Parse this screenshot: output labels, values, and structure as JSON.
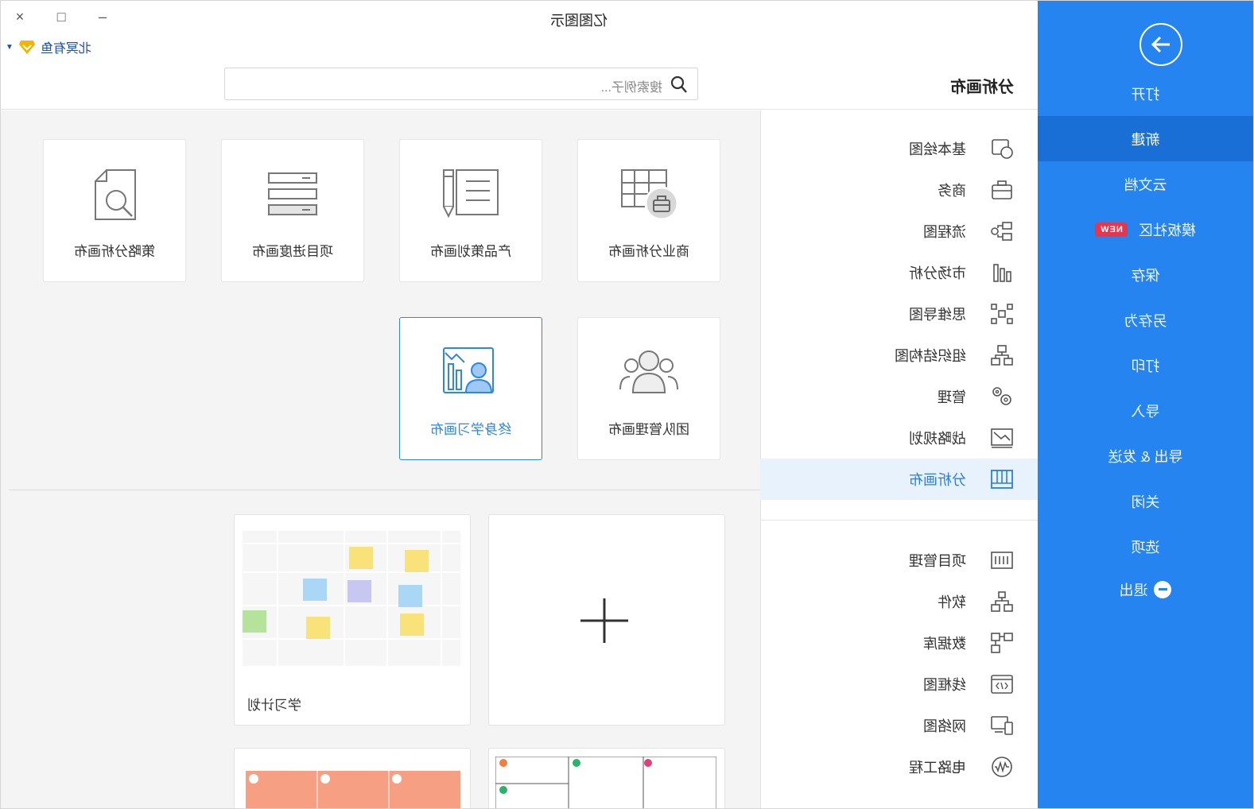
{
  "window": {
    "title": "亿图图示",
    "close_label": "×",
    "maximize_label": "□",
    "minimize_label": "–"
  },
  "user": {
    "name": "北冥有鱼"
  },
  "search": {
    "placeholder": "搜索例子..."
  },
  "command_panel": {
    "open_label": "打开",
    "items": [
      {
        "label": "新建",
        "active": true
      },
      {
        "label": "云文档"
      },
      {
        "label": "模板社区",
        "badge": "NEW"
      },
      {
        "label": "保存"
      },
      {
        "label": "另存为"
      },
      {
        "label": "打印"
      },
      {
        "label": "导入"
      },
      {
        "label": "导出 & 发送"
      },
      {
        "label": "关闭"
      },
      {
        "label": "选项"
      },
      {
        "label": "退出"
      }
    ],
    "accent_color": "#2684f0"
  },
  "categories": {
    "title": "分析画布",
    "group1": [
      {
        "label": "基本绘图",
        "icon": "shapes-icon"
      },
      {
        "label": "商务",
        "icon": "briefcase-icon"
      },
      {
        "label": "流程图",
        "icon": "flowchart-icon"
      },
      {
        "label": "市场分析",
        "icon": "bar-chart-icon"
      },
      {
        "label": "思维导图",
        "icon": "mindmap-icon"
      },
      {
        "label": "组织结构图",
        "icon": "org-chart-icon"
      },
      {
        "label": "管理",
        "icon": "gears-icon"
      },
      {
        "label": "战略规划",
        "icon": "trend-icon"
      },
      {
        "label": "分析画布",
        "icon": "canvas-grid-icon",
        "active": true
      }
    ],
    "group2": [
      {
        "label": "项目管理",
        "icon": "gantt-icon"
      },
      {
        "label": "软件",
        "icon": "software-tree-icon"
      },
      {
        "label": "数据库",
        "icon": "database-icon"
      },
      {
        "label": "线框图",
        "icon": "wireframe-icon"
      },
      {
        "label": "网络图",
        "icon": "network-icon"
      },
      {
        "label": "电路工程",
        "icon": "circuit-icon"
      }
    ]
  },
  "canvas_types": [
    {
      "label": "商业分析画布",
      "icon": "business-canvas-icon"
    },
    {
      "label": "产品策划画布",
      "icon": "product-plan-icon"
    },
    {
      "label": "项目进度画布",
      "icon": "project-progress-icon"
    },
    {
      "label": "策略分析画布",
      "icon": "strategy-doc-icon"
    },
    {
      "label": "团队管理画布",
      "icon": "team-icon"
    },
    {
      "label": "终身学习画布",
      "icon": "lifelong-learning-icon",
      "selected": true
    }
  ],
  "templates": [
    {
      "label": "",
      "kind": "new-blank"
    },
    {
      "label": "学习计划",
      "kind": "study-plan"
    }
  ]
}
